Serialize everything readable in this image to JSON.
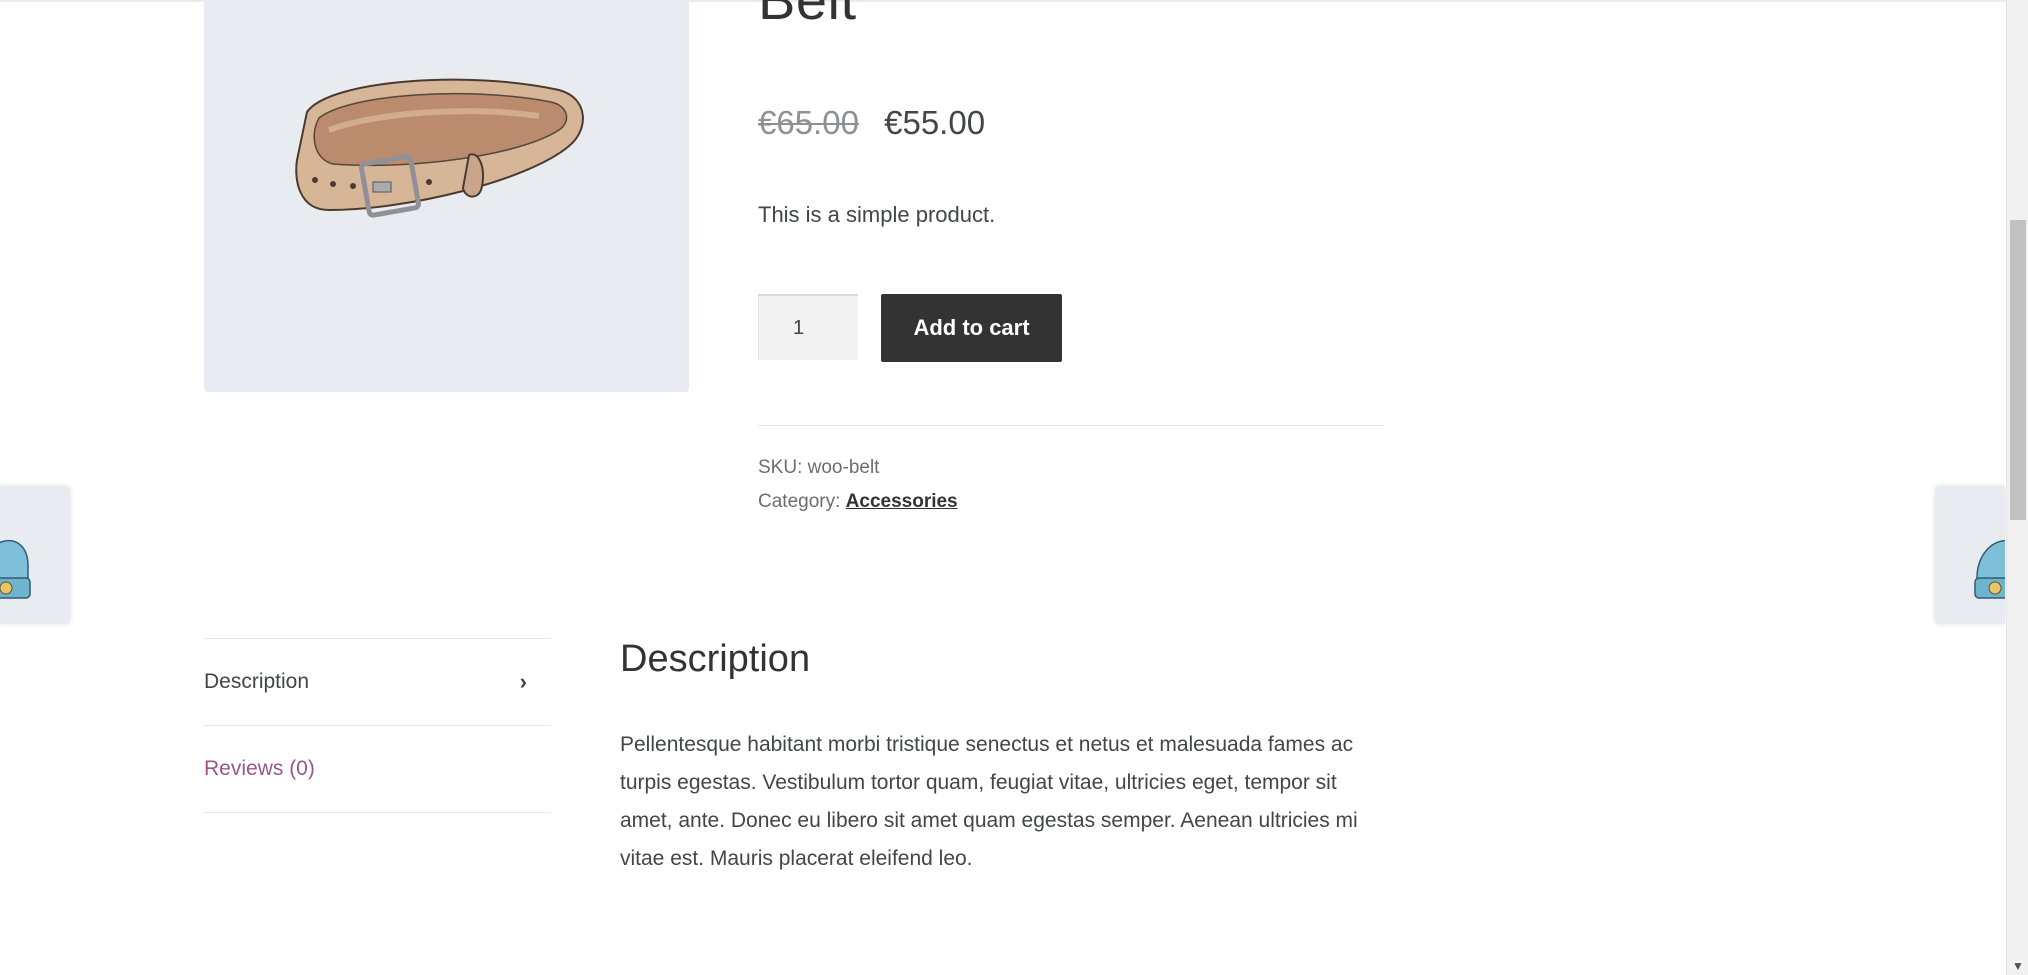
{
  "product": {
    "title": "Belt",
    "regular_price": "€65.00",
    "sale_price": "€55.00",
    "short_description": "This is a simple product.",
    "quantity": "1",
    "add_to_cart_label": "Add to cart",
    "sku_label": "SKU:",
    "sku_value": "woo-belt",
    "category_label": "Category:",
    "category_value": "Accessories"
  },
  "tabs": [
    {
      "label": "Description",
      "active": true
    },
    {
      "label": "Reviews (0)",
      "active": false
    }
  ],
  "description_panel": {
    "heading": "Description",
    "body": "Pellentesque habitant morbi tristique senectus et netus et malesuada fames ac turpis egestas. Vestibulum tortor quam, feugiat vitae, ultricies eget, tempor sit amet, ante. Donec eu libero sit amet quam egestas semper. Aenean ultricies mi vitae est. Mauris placerat eleifend leo."
  },
  "icons": {
    "tab_arrow": "chevron-right-icon",
    "scroll_down": "arrow-down-icon"
  },
  "colors": {
    "button_bg": "#333333",
    "link_purple": "#96588a",
    "image_bg": "#e8ecf1"
  }
}
